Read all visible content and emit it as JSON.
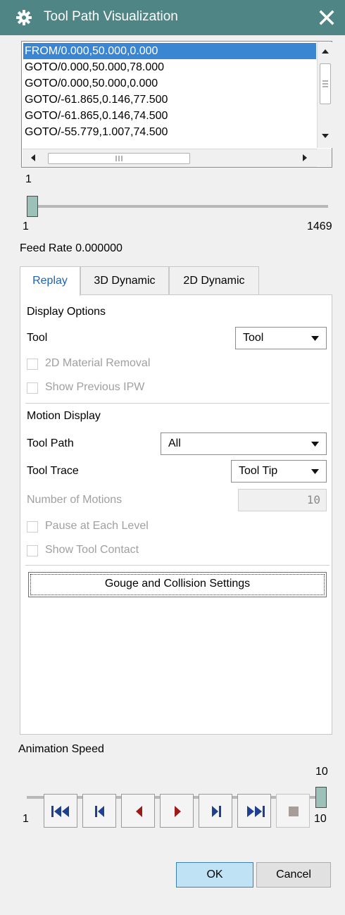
{
  "window": {
    "title": "Tool Path Visualization",
    "title_bg": "#4f8585"
  },
  "path_list": {
    "lines": [
      "FROM/0.000,50.000,0.000",
      "GOTO/0.000,50.000,78.000",
      "GOTO/0.000,50.000,0.000",
      "GOTO/-61.865,0.146,77.500",
      "GOTO/-61.865,0.146,74.500",
      "GOTO/-55.779,1.007,74.500"
    ],
    "selected_index": 0,
    "selection_color": "#3b86d3"
  },
  "motion_slider": {
    "current_label": "1",
    "min_label": "1",
    "max_label": "1469",
    "value": 1,
    "min": 1,
    "max": 1469
  },
  "feed_rate": "Feed Rate 0.000000",
  "tabs": [
    {
      "label": "Replay",
      "active": true
    },
    {
      "label": "3D Dynamic",
      "active": false
    },
    {
      "label": "2D Dynamic",
      "active": false
    }
  ],
  "display_options": {
    "heading": "Display Options",
    "tool_label": "Tool",
    "tool_value": "Tool",
    "material_removal": "2D Material Removal",
    "show_previous_ipw": "Show Previous IPW"
  },
  "motion_display": {
    "heading": "Motion Display",
    "tool_path_label": "Tool Path",
    "tool_path_value": "All",
    "tool_trace_label": "Tool Trace",
    "tool_trace_value": "Tool Tip",
    "number_of_motions_label": "Number of Motions",
    "number_of_motions_value": "10",
    "pause_each_level": "Pause at Each Level",
    "show_tool_contact": "Show Tool Contact"
  },
  "gouge_button": "Gouge and Collision Settings",
  "animation_speed": {
    "label": "Animation Speed",
    "current_label": "10",
    "min_label": "1",
    "max_label": "10",
    "value": 10,
    "min": 1,
    "max": 10
  },
  "playback": {
    "icon_color": "#1f3f8f",
    "play_color": "#9b1b1b",
    "stop_color": "#a79c9a",
    "buttons": [
      "rewind-to-start-icon",
      "step-back-icon",
      "play-reverse-icon",
      "play-forward-icon",
      "step-forward-icon",
      "fast-forward-to-end-icon",
      "stop-icon"
    ]
  },
  "dialog_buttons": {
    "ok": "OK",
    "cancel": "Cancel"
  }
}
